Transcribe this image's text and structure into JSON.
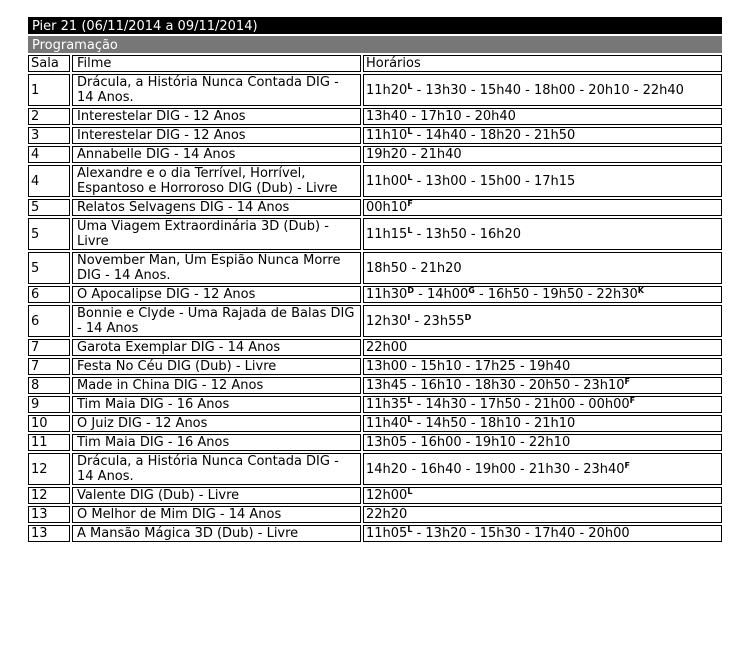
{
  "header": {
    "title": "Pier 21 (06/11/2014 a 09/11/2014)",
    "subtitle": "Programação"
  },
  "columns": {
    "sala": "Sala",
    "filme": "Filme",
    "horarios": "Horários"
  },
  "rows": [
    {
      "sala": "1",
      "filme": "Drácula, a História Nunca Contada DIG - 14 Anos.",
      "horarios": [
        [
          "11h20",
          "L"
        ],
        [
          "13h30",
          ""
        ],
        [
          "15h40",
          ""
        ],
        [
          "18h00",
          ""
        ],
        [
          "20h10",
          ""
        ],
        [
          "22h40",
          ""
        ]
      ]
    },
    {
      "sala": "2",
      "filme": "Interestelar DIG - 12 Anos",
      "horarios": [
        [
          "13h40",
          ""
        ],
        [
          "17h10",
          ""
        ],
        [
          "20h40",
          ""
        ]
      ]
    },
    {
      "sala": "3",
      "filme": "Interestelar DIG - 12 Anos",
      "horarios": [
        [
          "11h10",
          "L"
        ],
        [
          "14h40",
          ""
        ],
        [
          "18h20",
          ""
        ],
        [
          "21h50",
          ""
        ]
      ]
    },
    {
      "sala": "4",
      "filme": "Annabelle DIG - 14 Anos",
      "horarios": [
        [
          "19h20",
          ""
        ],
        [
          "21h40",
          ""
        ]
      ]
    },
    {
      "sala": "4",
      "filme": "Alexandre e o dia Terrível, Horrível, Espantoso e Horroroso DIG (Dub) - Livre",
      "horarios": [
        [
          "11h00",
          "L"
        ],
        [
          "13h00",
          ""
        ],
        [
          "15h00",
          ""
        ],
        [
          "17h15",
          ""
        ]
      ]
    },
    {
      "sala": "5",
      "filme": "Relatos Selvagens DIG - 14 Anos",
      "horarios": [
        [
          "00h10",
          "F"
        ]
      ]
    },
    {
      "sala": "5",
      "filme": "Uma Viagem Extraordinária 3D (Dub) - Livre",
      "horarios": [
        [
          "11h15",
          "L"
        ],
        [
          "13h50",
          ""
        ],
        [
          "16h20",
          ""
        ]
      ]
    },
    {
      "sala": "5",
      "filme": "November Man, Um Espião Nunca Morre DIG - 14 Anos.",
      "horarios": [
        [
          "18h50",
          ""
        ],
        [
          "21h20",
          ""
        ]
      ]
    },
    {
      "sala": "6",
      "filme": "O Apocalipse DIG - 12 Anos",
      "horarios": [
        [
          "11h30",
          "D"
        ],
        [
          "14h00",
          "G"
        ],
        [
          "16h50",
          ""
        ],
        [
          "19h50",
          ""
        ],
        [
          "22h30",
          "K"
        ]
      ]
    },
    {
      "sala": "6",
      "filme": "Bonnie e Clyde - Uma Rajada de Balas DIG - 14 Anos",
      "horarios": [
        [
          "12h30",
          "I"
        ],
        [
          "23h55",
          "D"
        ]
      ]
    },
    {
      "sala": "7",
      "filme": "Garota Exemplar DIG - 14 Anos",
      "horarios": [
        [
          "22h00",
          ""
        ]
      ]
    },
    {
      "sala": "7",
      "filme": "Festa No Céu DIG (Dub) - Livre",
      "horarios": [
        [
          "13h00",
          ""
        ],
        [
          "15h10",
          ""
        ],
        [
          "17h25",
          ""
        ],
        [
          "19h40",
          ""
        ]
      ]
    },
    {
      "sala": "8",
      "filme": "Made in China DIG - 12 Anos",
      "horarios": [
        [
          "13h45",
          ""
        ],
        [
          "16h10",
          ""
        ],
        [
          "18h30",
          ""
        ],
        [
          "20h50",
          ""
        ],
        [
          "23h10",
          "F"
        ]
      ]
    },
    {
      "sala": "9",
      "filme": "Tim Maia DIG - 16 Anos",
      "horarios": [
        [
          "11h35",
          "L"
        ],
        [
          "14h30",
          ""
        ],
        [
          "17h50",
          ""
        ],
        [
          "21h00",
          ""
        ],
        [
          "00h00",
          "F"
        ]
      ]
    },
    {
      "sala": "10",
      "filme": "O Juiz DIG - 12 Anos",
      "horarios": [
        [
          "11h40",
          "L"
        ],
        [
          "14h50",
          ""
        ],
        [
          "18h10",
          ""
        ],
        [
          "21h10",
          ""
        ]
      ]
    },
    {
      "sala": "11",
      "filme": "Tim Maia DIG - 16 Anos",
      "horarios": [
        [
          "13h05",
          ""
        ],
        [
          "16h00",
          ""
        ],
        [
          "19h10",
          ""
        ],
        [
          "22h10",
          ""
        ]
      ]
    },
    {
      "sala": "12",
      "filme": "Drácula, a História Nunca Contada DIG - 14 Anos.",
      "horarios": [
        [
          "14h20",
          ""
        ],
        [
          "16h40",
          ""
        ],
        [
          "19h00",
          ""
        ],
        [
          "21h30",
          ""
        ],
        [
          "23h40",
          "F"
        ]
      ]
    },
    {
      "sala": "12",
      "filme": "Valente DIG (Dub) - Livre",
      "horarios": [
        [
          "12h00",
          "L"
        ]
      ]
    },
    {
      "sala": "13",
      "filme": "O Melhor de Mim DIG - 14 Anos",
      "horarios": [
        [
          "22h20",
          ""
        ]
      ]
    },
    {
      "sala": "13",
      "filme": "A Mansão Mágica 3D (Dub) - Livre",
      "horarios": [
        [
          "11h05",
          "L"
        ],
        [
          "13h20",
          ""
        ],
        [
          "15h30",
          ""
        ],
        [
          "17h40",
          ""
        ],
        [
          "20h00",
          ""
        ]
      ]
    }
  ]
}
